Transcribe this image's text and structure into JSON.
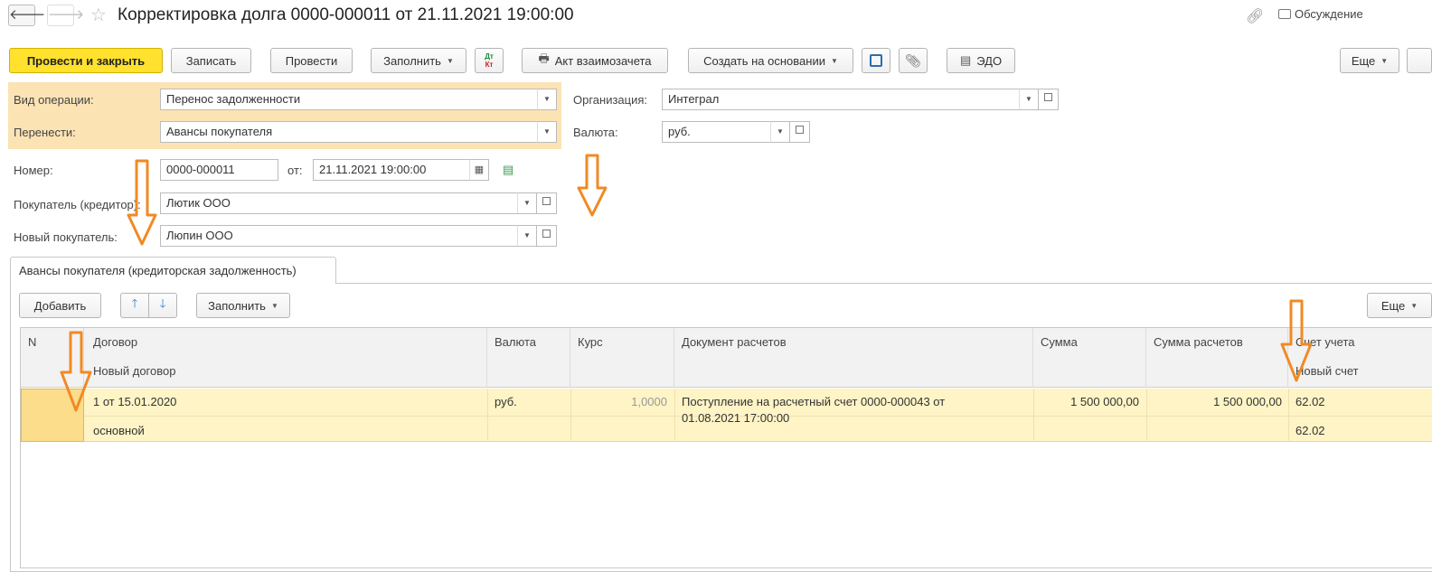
{
  "header": {
    "back_label": "🡐",
    "forward_label": "🡒",
    "title": "Корректировка долга 0000-000011 от 21.11.2021 19:00:00",
    "discussion_label": "Обсуждение"
  },
  "toolbar": {
    "post_close": "Провести и закрыть",
    "save": "Записать",
    "post": "Провести",
    "fill": "Заполнить",
    "dtkt_top": "Дт",
    "dtkt_bottom": "Кт",
    "offset_act": "Акт взаимозачета",
    "create_based": "Создать на основании",
    "edo": "ЭДО",
    "more": "Еще"
  },
  "form": {
    "operation_label": "Вид операции:",
    "operation_value": "Перенос задолженности",
    "transfer_label": "Перенести:",
    "transfer_value": "Авансы покупателя",
    "org_label": "Организация:",
    "org_value": "Интеграл",
    "currency_label": "Валюта:",
    "currency_value": "руб.",
    "number_label": "Номер:",
    "number_value": "0000-000011",
    "date_label": "от:",
    "date_value": "21.11.2021 19:00:00",
    "buyer_label": "Покупатель (кредитор):",
    "buyer_value": "Лютик ООО",
    "new_buyer_label": "Новый покупатель:",
    "new_buyer_value": "Люпин ООО"
  },
  "tab": {
    "label": "Авансы покупателя (кредиторская задолженность)"
  },
  "table_toolbar": {
    "add": "Добавить",
    "fill": "Заполнить",
    "more": "Еще"
  },
  "table": {
    "headers": {
      "n": "N",
      "contract": "Договор",
      "new_contract": "Новый договор",
      "currency": "Валюта",
      "rate": "Курс",
      "doc": "Документ расчетов",
      "sum": "Сумма",
      "sum_settle": "Сумма расчетов",
      "account": "Счет учета",
      "new_account": "Новый счет"
    },
    "rows": [
      {
        "contract": "1 от 15.01.2020",
        "new_contract": "основной",
        "currency": "руб.",
        "rate": "1,0000",
        "doc_line1": "Поступление на расчетный счет 0000-000043 от",
        "doc_line2": "01.08.2021 17:00:00",
        "sum": "1 500 000,00",
        "sum_settle": "1 500 000,00",
        "account": "62.02",
        "new_account": "62.02"
      }
    ]
  },
  "colors": {
    "accent_yellow": "#ffe12e",
    "highlight_orange": "#fbe3b4",
    "row_highlight": "#fef4c6",
    "annotation_arrow": "#f08a24"
  }
}
